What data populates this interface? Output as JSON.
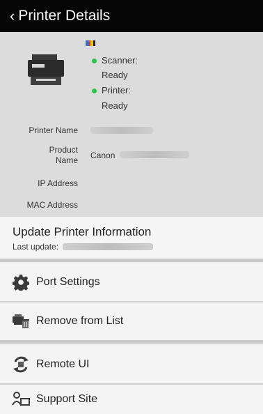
{
  "header": {
    "back_icon": "chevron-left-icon",
    "title": "Printer Details"
  },
  "status": {
    "ink_icon": "ink-level-icon",
    "ink_colors": [
      "#2f6fd6",
      "#e33b3b",
      "#f2c200",
      "#222222"
    ],
    "scanner_label": "Scanner:",
    "scanner_value": "Ready",
    "printer_label": "Printer:",
    "printer_value": "Ready",
    "ready_color": "#29c44a"
  },
  "details": {
    "printer_name_label": "Printer Name",
    "product_name_label_line1": "Product",
    "product_name_label_line2": "Name",
    "product_name_value": "Canon",
    "ip_address_label": "IP Address",
    "mac_address_label": "MAC Address"
  },
  "update": {
    "title": "Update Printer Information",
    "subtitle": "Last update:"
  },
  "menu": {
    "port_settings": {
      "label": "Port Settings",
      "icon": "gear-icon"
    },
    "remove": {
      "label": "Remove from List",
      "icon": "remove-printer-icon"
    },
    "remote_ui": {
      "label": "Remote UI",
      "icon": "remote-ui-icon"
    },
    "support": {
      "label": "Support Site",
      "icon": "support-site-icon"
    }
  }
}
